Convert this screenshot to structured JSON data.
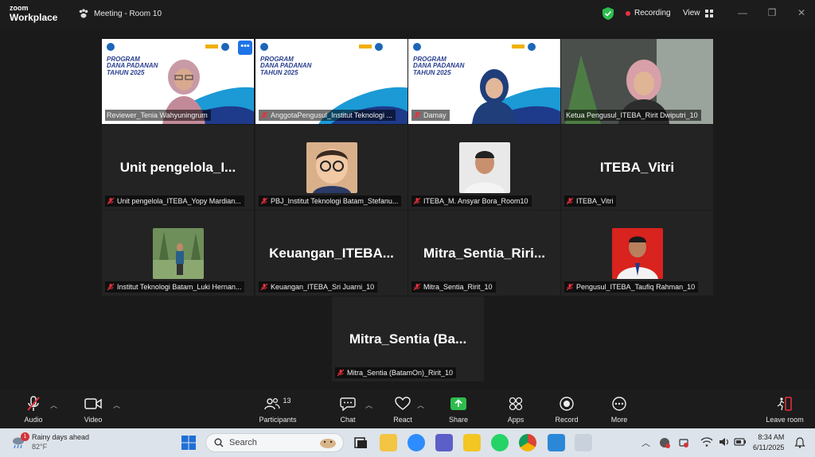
{
  "app": {
    "brand_top": "zoom",
    "brand_bottom": "Workplace",
    "meeting_title": "Meeting - Room 10"
  },
  "header": {
    "recording": "Recording",
    "view": "View"
  },
  "slide": {
    "title_line1": "PROGRAM",
    "title_line2": "DANA PADANAN",
    "title_line3": "TAHUN 2025"
  },
  "tiles": [
    {
      "label": "Reviewer_Tenia Wahyuningrum"
    },
    {
      "label": "AnggotaPengusul_Institut Teknologi ..."
    },
    {
      "label": "Damay"
    },
    {
      "label": "Ketua Pengusul_ITEBA_Ririt Dwiputri_10"
    },
    {
      "name": "Unit  pengelola_I...",
      "label": "Unit pengelola_ITEBA_Yopy Mardian..."
    },
    {
      "label": "PBJ_Institut Teknologi Batam_Stefanu..."
    },
    {
      "label": "ITEBA_M. Ansyar Bora_Room10"
    },
    {
      "name": "ITEBA_Vitri",
      "label": "ITEBA_Vitri"
    },
    {
      "label": "Institut Teknologi Batam_Luki Hernan..."
    },
    {
      "name": "Keuangan_ITEBA...",
      "label": "Keuangan_ITEBA_Sri Juarni_10"
    },
    {
      "name": "Mitra_Sentia_Riri...",
      "label": "Mitra_Sentia_Ririt_10"
    },
    {
      "label": "Pengusul_ITEBA_Taufiq Rahman_10"
    },
    {
      "name": "Mitra_Sentia  (Ba...",
      "label": "Mitra_Sentia (BatamOn)_Ririt_10"
    }
  ],
  "toolbar": {
    "audio": "Audio",
    "video": "Video",
    "participants": "Participants",
    "participants_count": "13",
    "chat": "Chat",
    "react": "React",
    "share": "Share",
    "apps": "Apps",
    "record": "Record",
    "more": "More",
    "leave": "Leave room"
  },
  "taskbar": {
    "weather_title": "Rainy days ahead",
    "weather_temp": "82°F",
    "weather_badge": "1",
    "search_placeholder": "Search",
    "time": "8:34 AM",
    "date": "6/11/2025"
  },
  "colors": {
    "active_border": "#35d46a",
    "share_green": "#2dbd4d",
    "record_red": "#e8303d"
  }
}
